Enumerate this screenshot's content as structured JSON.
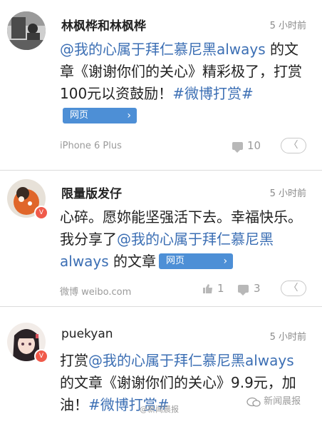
{
  "posts": [
    {
      "name": "林枫桦和林枫桦",
      "time": "5 小时前",
      "body": {
        "mention": "@我的心属于拜仁慕尼黑always",
        "text1": " 的文章《谢谢你们的关心》精彩极了，打赏100元以资鼓励！",
        "hashtag": "#微博打赏#"
      },
      "chip": "网页",
      "source": "iPhone 6 Plus",
      "comment_count": "10",
      "avatar_icon": "user-photo-icon"
    },
    {
      "name": "限量版发仔",
      "time": "5 小时前",
      "body": {
        "text1": "心碎。愿妳能坚强活下去。幸福快乐。 我分享了",
        "mention": "@我的心属于拜仁慕尼黑always",
        "text2": " 的文章"
      },
      "chip": "网页",
      "source": "微博 weibo.com",
      "like_count": "1",
      "comment_count": "3",
      "avatar_icon": "cartoon-avatar-icon"
    },
    {
      "name": "puekyan",
      "time": "5 小时前",
      "body": {
        "text1": "打赏",
        "mention": "@我的心属于拜仁慕尼黑always",
        "text2": " 的文章《谢谢你们的关心》9.9元，加油！",
        "hashtag": "#微博打赏#"
      },
      "avatar_icon": "anime-girl-avatar-icon"
    }
  ],
  "watermark": "新闻晨报",
  "watermark_mid": "@新闻晨报",
  "more_symbol": "〈",
  "badge_symbol": "V",
  "chip_chevron": "›",
  "colors": {
    "link": "#3c6fb4",
    "chip": "#4d8fd6",
    "badge": "#f05a4a"
  }
}
